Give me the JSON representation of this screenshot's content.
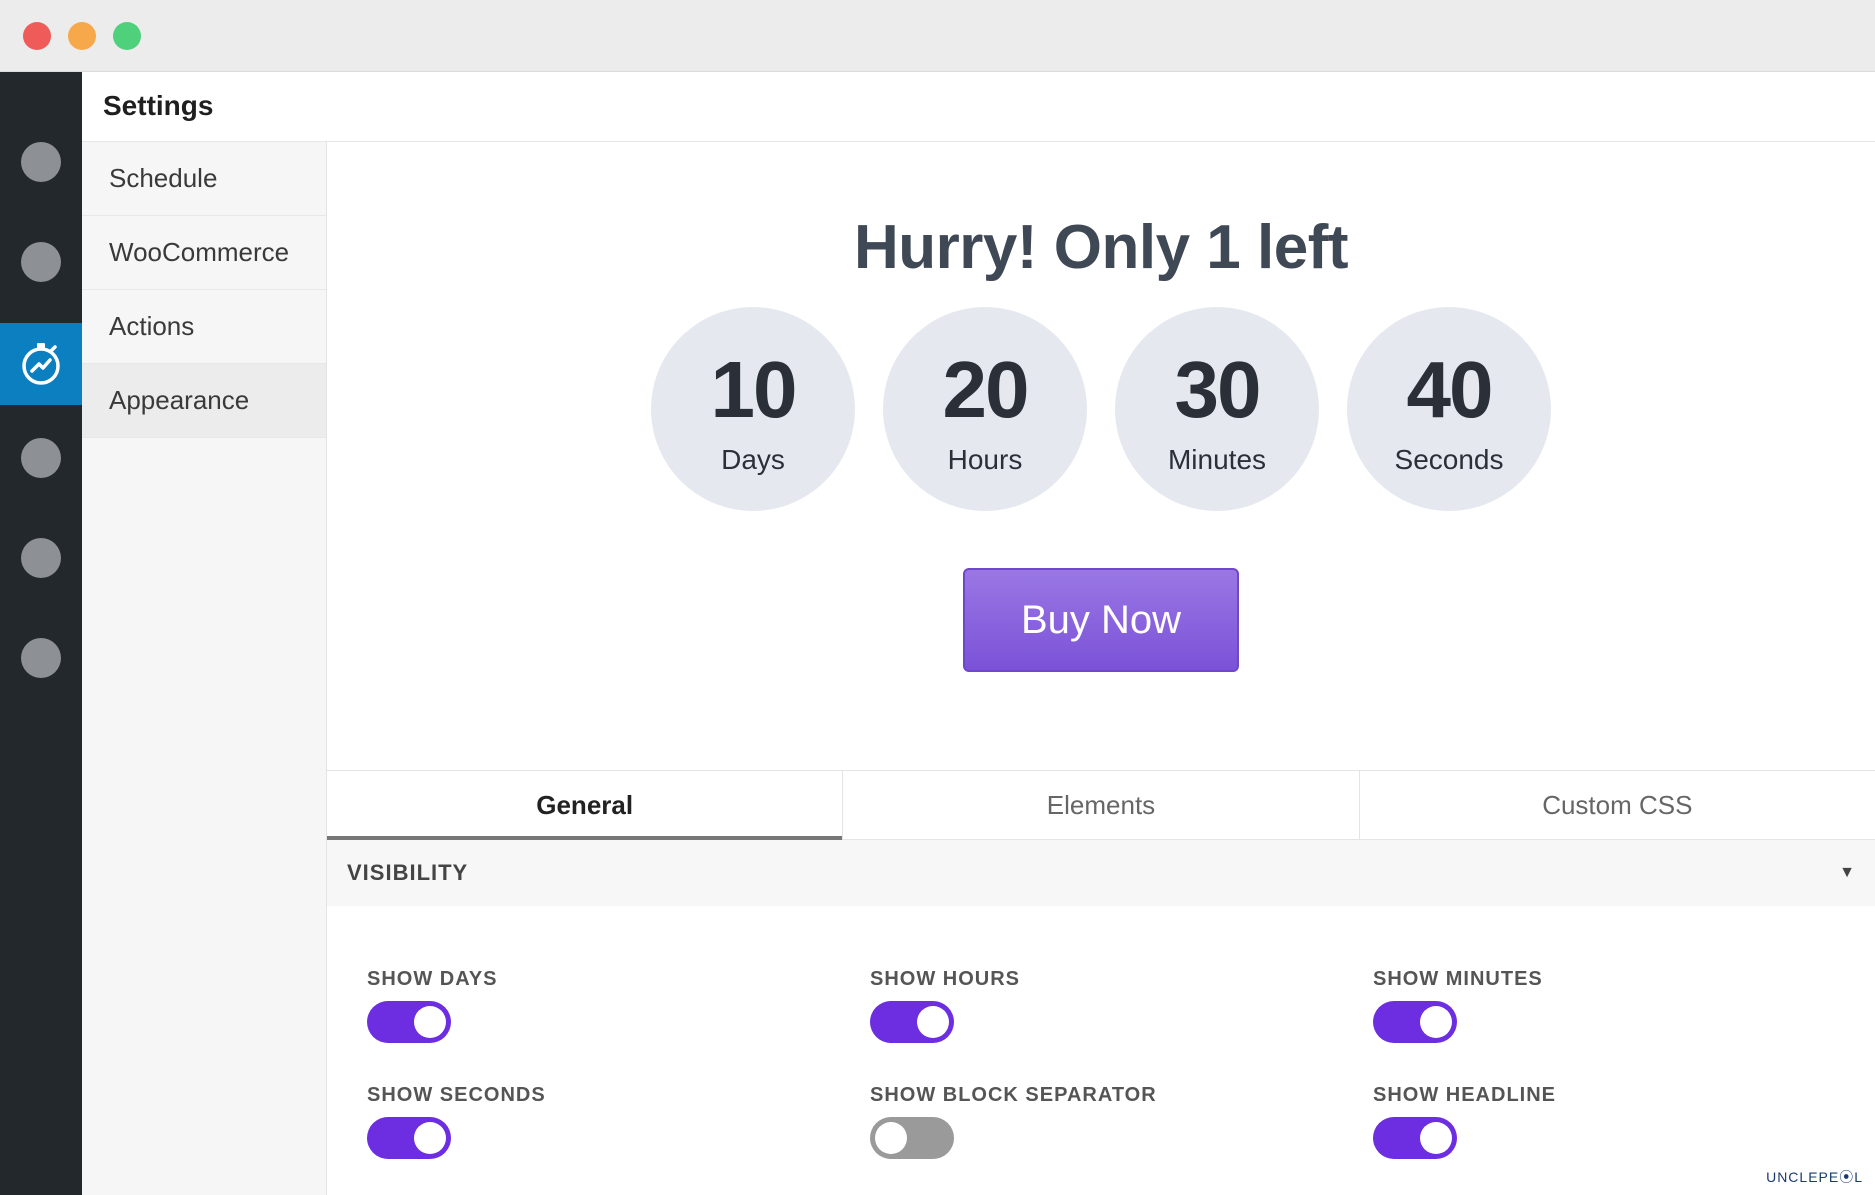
{
  "settings": {
    "title": "Settings"
  },
  "subnav": {
    "items": [
      {
        "label": "Schedule"
      },
      {
        "label": "WooCommerce"
      },
      {
        "label": "Actions"
      },
      {
        "label": "Appearance"
      }
    ],
    "active": "Appearance"
  },
  "preview": {
    "headline": "Hurry! Only 1 left",
    "countdown": [
      {
        "value": "10",
        "unit": "Days"
      },
      {
        "value": "20",
        "unit": "Hours"
      },
      {
        "value": "30",
        "unit": "Minutes"
      },
      {
        "value": "40",
        "unit": "Seconds"
      }
    ],
    "button_label": "Buy Now"
  },
  "tabs": [
    {
      "label": "General"
    },
    {
      "label": "Elements"
    },
    {
      "label": "Custom CSS"
    }
  ],
  "visibility": {
    "title": "VISIBILITY",
    "options": [
      {
        "label": "SHOW DAYS",
        "on": true
      },
      {
        "label": "SHOW HOURS",
        "on": true
      },
      {
        "label": "SHOW MINUTES",
        "on": true
      },
      {
        "label": "SHOW SECONDS",
        "on": true
      },
      {
        "label": "SHOW BLOCK SEPARATOR",
        "on": false
      },
      {
        "label": "SHOW HEADLINE",
        "on": true
      }
    ]
  },
  "colors": {
    "accent": "#6c2ee0",
    "button": "#7b52d8",
    "rail": "#23282d",
    "rail_active": "#0b7fc0"
  },
  "icons": {
    "rail_active": "stopwatch-icon",
    "section_caret": "caret-down-icon"
  },
  "watermark": "UNCLEPE⦿L"
}
